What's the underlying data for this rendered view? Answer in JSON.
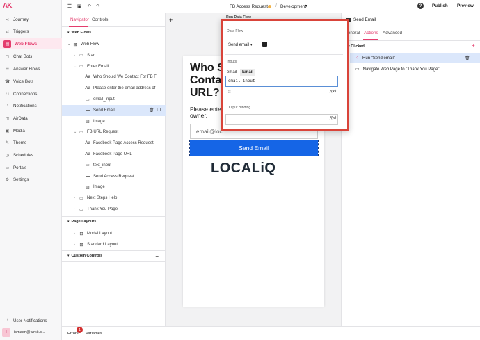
{
  "app": {
    "logo": "AK"
  },
  "leftnav": {
    "items": [
      {
        "label": "Journey",
        "icon": "journey-icon",
        "glyph": "⋖"
      },
      {
        "label": "Triggers",
        "icon": "triggers-icon",
        "glyph": "⇄"
      },
      {
        "label": "Web Flows",
        "icon": "web-flows-icon",
        "glyph": "▤"
      },
      {
        "label": "Chat Bots",
        "icon": "chat-bots-icon",
        "glyph": "▢"
      },
      {
        "label": "Answer Flows",
        "icon": "answer-flows-icon",
        "glyph": "☰"
      },
      {
        "label": "Voice Bots",
        "icon": "voice-bots-icon",
        "glyph": "☎"
      },
      {
        "label": "Connections",
        "icon": "connections-icon",
        "glyph": "⚇"
      },
      {
        "label": "Notifications",
        "icon": "notifications-icon",
        "glyph": "♪"
      },
      {
        "label": "AirData",
        "icon": "airdata-icon",
        "glyph": "◫"
      },
      {
        "label": "Media",
        "icon": "media-icon",
        "glyph": "▣"
      },
      {
        "label": "Theme",
        "icon": "theme-icon",
        "glyph": "✎"
      },
      {
        "label": "Schedules",
        "icon": "schedules-icon",
        "glyph": "◷"
      },
      {
        "label": "Portals",
        "icon": "portals-icon",
        "glyph": "▭"
      },
      {
        "label": "Settings",
        "icon": "settings-icon",
        "glyph": "⚙"
      }
    ],
    "user_notifications": "User Notifications",
    "user_initial": "I",
    "user_email": "ismaen@airkit.c..."
  },
  "topbar": {
    "flow_title": "FB Access Request",
    "environment": "Development",
    "help": "?",
    "publish": "Publish",
    "preview": "Preview"
  },
  "navigator": {
    "tabs": [
      "Navigator",
      "Controls"
    ],
    "web_flows_heading": "Web Flows",
    "tree": [
      {
        "label": "Web Flow",
        "icon": "web-flow-icon",
        "glyph": "⊞",
        "indent": 1,
        "caret": "v"
      },
      {
        "label": "Start",
        "icon": "page-icon",
        "glyph": "▭",
        "indent": 2,
        "caret": ">"
      },
      {
        "label": "Enter Email",
        "icon": "page-icon",
        "glyph": "▭",
        "indent": 2,
        "caret": "v"
      },
      {
        "label": "Who Should We Contact For FB F",
        "icon": "text-icon",
        "glyph": "Aa",
        "indent": 3,
        "caret": ""
      },
      {
        "label": "Please enter the email address of",
        "icon": "text-icon",
        "glyph": "Aa",
        "indent": 3,
        "caret": ""
      },
      {
        "label": "email_input",
        "icon": "input-icon",
        "glyph": "▭",
        "indent": 3,
        "caret": ""
      },
      {
        "label": "Send Email",
        "icon": "button-icon",
        "glyph": "▬",
        "indent": 3,
        "caret": "",
        "selected": true
      },
      {
        "label": "Image",
        "icon": "image-icon",
        "glyph": "▨",
        "indent": 3,
        "caret": ""
      },
      {
        "label": "FB URL Request",
        "icon": "page-icon",
        "glyph": "▭",
        "indent": 2,
        "caret": "v"
      },
      {
        "label": "Facebook Page Access Request",
        "icon": "text-icon",
        "glyph": "Aa",
        "indent": 3,
        "caret": ""
      },
      {
        "label": "Facebook Page URL",
        "icon": "text-icon",
        "glyph": "Aa",
        "indent": 3,
        "caret": ""
      },
      {
        "label": "text_input",
        "icon": "input-icon",
        "glyph": "▭",
        "indent": 3,
        "caret": ""
      },
      {
        "label": "Send Access Request",
        "icon": "button-icon",
        "glyph": "▬",
        "indent": 3,
        "caret": ""
      },
      {
        "label": "Image",
        "icon": "image-icon",
        "glyph": "▨",
        "indent": 3,
        "caret": ""
      },
      {
        "label": "Next Steps Help",
        "icon": "page-icon",
        "glyph": "▭",
        "indent": 2,
        "caret": ">"
      },
      {
        "label": "Thank You Page",
        "icon": "page-icon",
        "glyph": "▭",
        "indent": 2,
        "caret": ">"
      }
    ],
    "page_layouts_heading": "Page Layouts",
    "page_layouts": [
      {
        "label": "Modal Layout",
        "glyph": "⊟"
      },
      {
        "label": "Standard Layout",
        "glyph": "⊞"
      }
    ],
    "custom_controls_heading": "Custom Controls"
  },
  "canvas": {
    "heading": "Who S... Conta... URL?",
    "heading_lines": [
      "Who S",
      "Conta",
      "URL?"
    ],
    "subtext": "Please ente... owner.",
    "subtext_lines": [
      "Please ente",
      "owner."
    ],
    "email_placeholder": "email@loc",
    "send_button": "Send Email",
    "logo": "LOCALiQ"
  },
  "dataflow_popup": {
    "header": "Run Data Flow",
    "data_flow_label": "Data Flow",
    "data_flow_value": "Send email",
    "inputs_label": "Inputs",
    "input_name": "email",
    "input_type": "Email",
    "input_value": "email_input",
    "fx": "f(x)",
    "output_binding_label": "Output Binding"
  },
  "props": {
    "title": "Send Email",
    "tabs": [
      "General",
      "Actions",
      "Advanced"
    ],
    "event_heading": "Clicked",
    "actions": [
      {
        "label": "Run \"Send email\"",
        "icon": "data-flow-icon",
        "selected": true
      },
      {
        "label": "Navigate Web Page to \"Thank You Page\"",
        "icon": "navigate-icon",
        "selected": false
      }
    ]
  },
  "bottombar": {
    "errors": "Errors",
    "errors_count": "1",
    "variables": "Variables"
  },
  "colors": {
    "accent": "#e43c6d",
    "selection": "#dbe7fb",
    "send_button": "#1565e6",
    "highlight_box": "#d9443a"
  }
}
